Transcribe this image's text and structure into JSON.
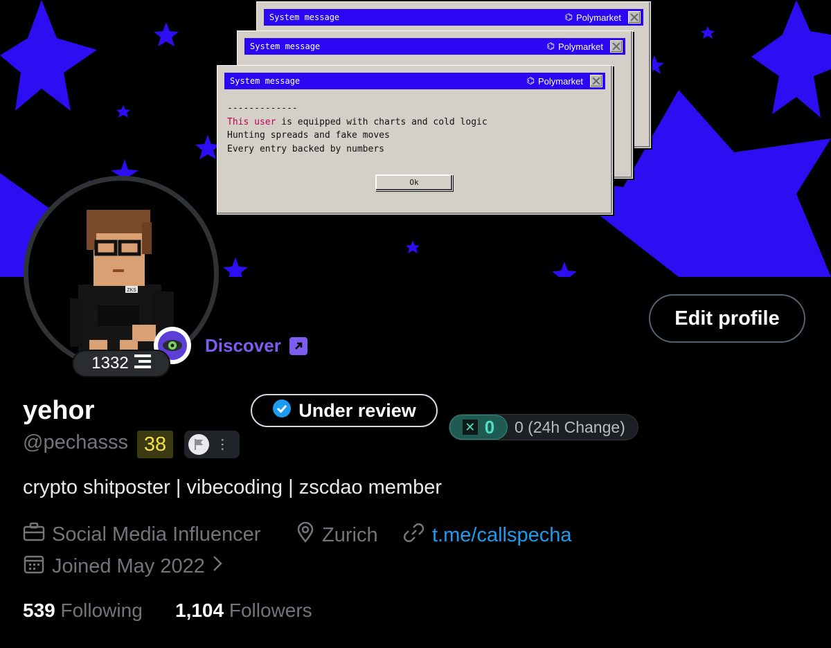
{
  "banner": {
    "windows": [
      {
        "title": "System message",
        "brand": "Polymarket"
      },
      {
        "title": "System message",
        "brand": "Polymarket"
      },
      {
        "title": "System message",
        "brand": "Polymarket"
      }
    ],
    "dialog": {
      "separator": "-------------",
      "highlight": "This user",
      "line1_rest": " is equipped with charts and cold logic",
      "line2": "Hunting spreads and fake moves",
      "line3": "Every entry backed by numbers",
      "ok_label": "Ok"
    },
    "colors": {
      "star": "#2d0df2",
      "titlebar": "#2a06f2"
    }
  },
  "avatar": {
    "icon": "pixel-avatar",
    "shirt_tag": "ZKS"
  },
  "score": {
    "value": "1332",
    "icon": "layers-icon"
  },
  "discover": {
    "label": "Discover",
    "icon": "arrow-up-right-icon"
  },
  "actions": {
    "edit_profile": "Edit profile"
  },
  "profile": {
    "name": "yehor",
    "verification": "Under review",
    "handle": "@pechasss",
    "level": "38",
    "bio": "crypto shitposter | vibecoding | zscdao member"
  },
  "token": {
    "value": "0",
    "change_label": "0 (24h Change)"
  },
  "meta": {
    "job": "Social Media Influencer",
    "location": "Zurich",
    "link": "t.me/callspecha",
    "joined": "Joined May 2022"
  },
  "stats": {
    "following_count": "539",
    "following_label": "Following",
    "followers_count": "1,104",
    "followers_label": "Followers"
  }
}
